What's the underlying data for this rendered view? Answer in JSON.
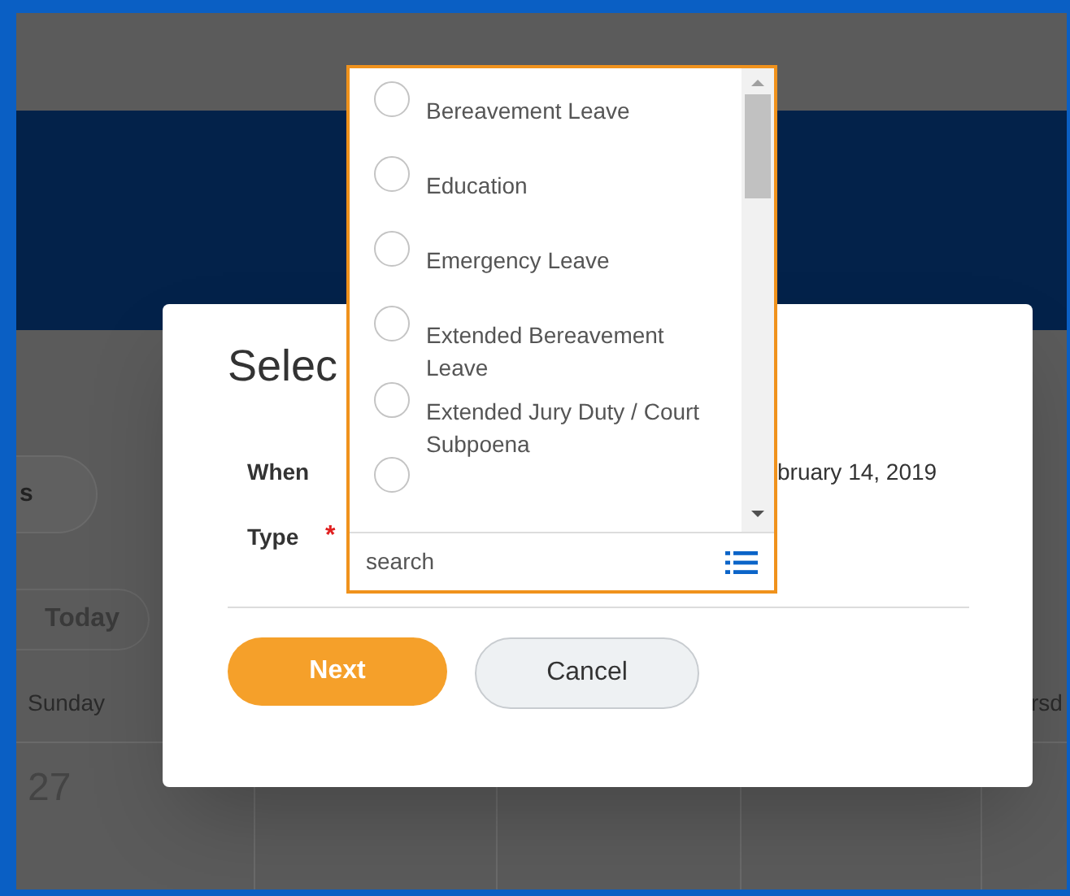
{
  "background": {
    "pill_button": "s",
    "today_button": "Today",
    "day_headers": [
      {
        "label": "Sunday"
      },
      {
        "label": "rsd"
      }
    ],
    "dates": [
      {
        "label": "27"
      }
    ]
  },
  "dialog": {
    "title": "Selec",
    "fields": [
      {
        "label": "When",
        "value": "bruary 14, 2019"
      },
      {
        "label": "Type",
        "required_mark": "*"
      }
    ],
    "buttons": [
      {
        "label": "Next",
        "kind": "primary"
      },
      {
        "label": "Cancel",
        "kind": "secondary"
      }
    ]
  },
  "dropdown": {
    "options": [
      {
        "label": "Bereavement Leave",
        "selected": false
      },
      {
        "label": "Education",
        "selected": false
      },
      {
        "label": "Emergency Leave",
        "selected": false
      },
      {
        "label": "Extended Bereavement Leave",
        "selected": false
      },
      {
        "label": "Extended Jury Duty / Court Subpoena",
        "selected": false
      },
      {
        "selected": false
      }
    ],
    "search": {
      "placeholder": "search"
    }
  }
}
